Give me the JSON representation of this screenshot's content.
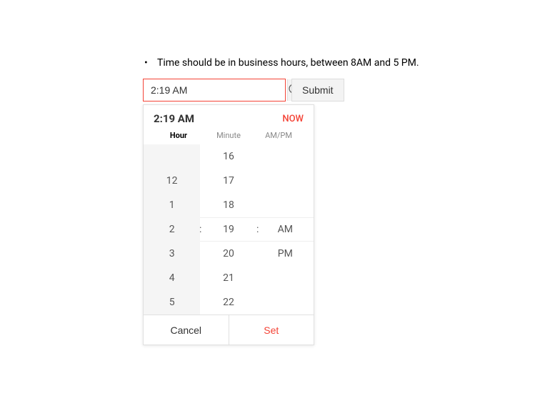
{
  "instruction": "Time should be in business hours, between 8AM and 5 PM.",
  "input": {
    "value": "2:19 AM"
  },
  "submit_label": "Submit",
  "popup": {
    "current_time": "2:19 AM",
    "now_label": "NOW",
    "headers": {
      "hour": "Hour",
      "minute": "Minute",
      "ampm": "AM/PM"
    },
    "hours": [
      "",
      "12",
      "1",
      "2",
      "3",
      "4",
      "5"
    ],
    "minutes": [
      "16",
      "17",
      "18",
      "19",
      "20",
      "21",
      "22"
    ],
    "ampm": [
      "",
      "",
      "",
      "AM",
      "PM",
      "",
      ""
    ],
    "selected_index": 3,
    "cancel_label": "Cancel",
    "set_label": "Set"
  }
}
